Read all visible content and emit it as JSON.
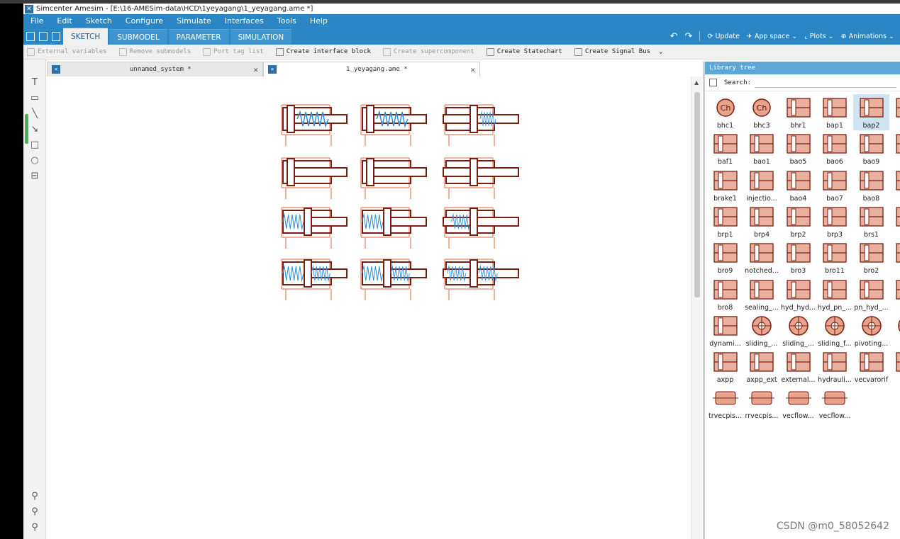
{
  "window": {
    "title": "Simcenter Amesim - [E:\\16-AMESim-data\\HCD\\1yeyagang\\1_yeyagang.ame *]"
  },
  "menu": [
    "File",
    "Edit",
    "Sketch",
    "Configure",
    "Simulate",
    "Interfaces",
    "Tools",
    "Help"
  ],
  "mode_tabs": [
    "SKETCH",
    "SUBMODEL",
    "PARAMETER",
    "SIMULATION"
  ],
  "active_mode": "SKETCH",
  "right_tools": {
    "update": "Update",
    "app_space": "App space",
    "plots": "Plots",
    "animations": "Animations"
  },
  "toolbar": {
    "external_variables": "External variables",
    "remove_submodels": "Remove submodels",
    "port_tag_list": "Port tag list",
    "create_interface_block": "Create interface block",
    "create_supercomponent": "Create supercomponent",
    "create_statechart": "Create Statechart",
    "create_signal_bus": "Create Signal Bus"
  },
  "doc_tabs": [
    {
      "label": "unnamed_system *"
    },
    {
      "label": "1_yeyagang.ame *"
    }
  ],
  "library": {
    "title": "Library tree",
    "search_label": "Search:",
    "search_value": "",
    "items": [
      "bhc1",
      "bhc3",
      "bhr1",
      "bap1",
      "bap2",
      "b",
      "baf1",
      "bao1",
      "bao5",
      "bao6",
      "bao9",
      "not",
      "brake1",
      "injectio...",
      "bao4",
      "bao7",
      "bao8",
      "sea",
      "brp1",
      "brp4",
      "brp2",
      "brp3",
      "brs1",
      "l",
      "bro9",
      "notched...",
      "bro3",
      "bro11",
      "bro2",
      "bra",
      "bro8",
      "sealing_...",
      "hyd_hyd...",
      "hyd_pn_...",
      "pn_hyd_...",
      "hcd",
      "dynami...",
      "sliding_...",
      "sliding_...",
      "sliding_f...",
      "pivoting...",
      "pivo",
      "axpp",
      "axpp_ext",
      "external...",
      "hydrauli...",
      "vecvarorif",
      "vec",
      "trvecpis...",
      "rrvecpis...",
      "vecflow...",
      "vecflow..."
    ],
    "selected": "bap2"
  },
  "watermark": "CSDN @m0_58052642",
  "colors": {
    "titlebar_blue": "#2a86c4",
    "lib_header": "#5da7d8",
    "component_fill": "#d9826a",
    "component_dark": "#7a1e12",
    "spring_blue": "#2d8fd5"
  }
}
